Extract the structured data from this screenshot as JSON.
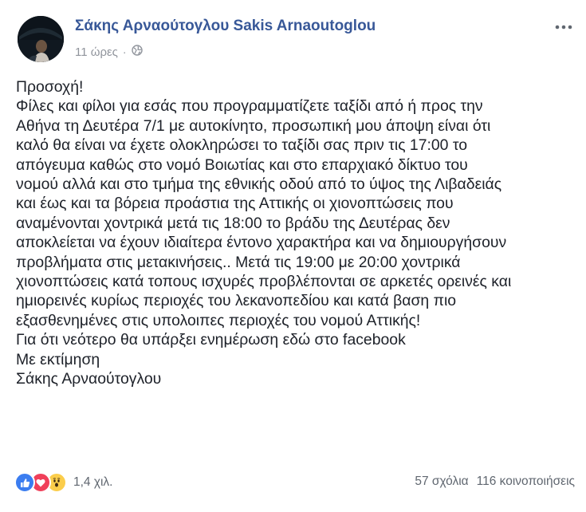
{
  "post": {
    "author": "Σάκης Αρναούτογλου Sakis Arnaoutoglou",
    "time": "11 ώρες",
    "separator": "·",
    "privacy_icon": "globe-icon",
    "more_icon": "more-options-icon",
    "lines": [
      "Προσοχή!",
      "Φίλες και φίλοι για εσάς που προγραμματίζετε ταξίδι από ή προς την",
      "Αθήνα τη Δευτέρα 7/1 με αυτοκίνητο, προσωπική μου άποψη είναι ότι",
      "καλό θα είναι να έχετε ολοκληρώσει το ταξίδι σας πριν τις 17:00 το",
      "απόγευμα καθώς στο νομό Βοιωτίας και στο επαρχιακό δίκτυο του",
      "νομού αλλά και στο τμήμα της εθνικής οδού από το ύψος της Λιβαδειάς",
      "και έως και τα βόρεια προάστια της Αττικής οι χιονοπτώσεις που",
      "αναμένονται χοντρικά μετά τις 18:00 το βράδυ της Δευτέρας δεν",
      "αποκλείεται να έχουν ιδιαίτερα έντονο χαρακτήρα και να δημιουργήσουν",
      "προβλήματα στις μετακινήσεις.. Μετά τις 19:00 με 20:00 χοντρικά",
      "χιονοπτώσεις κατά τοπους ισχυρές προβλέπονται σε αρκετές ορεινές και",
      "ημιορεινές κυρίως περιοχές του λεκανοπεδίου και κατά βαση πιο",
      "εξασθενημένες στις υπολοιπες περιοχές του νομού Αττικής!",
      "Για ότι νεότερο θα υπάρξει ενημέρωση εδώ στο facebook",
      "Με εκτίμηση",
      "Σάκης Αρναούτογλου"
    ]
  },
  "footer": {
    "reaction_icons": [
      "like-icon",
      "love-icon",
      "wow-icon"
    ],
    "reaction_count": "1,4 χιλ.",
    "comments": "57 σχόλια",
    "shares": "116 κοινοποιήσεις"
  },
  "colors": {
    "author": "#385898",
    "meta": "#90949c",
    "text": "#1d2129",
    "like": "#3b7df0",
    "love": "#f0405a",
    "wow": "#fbcd4b"
  }
}
